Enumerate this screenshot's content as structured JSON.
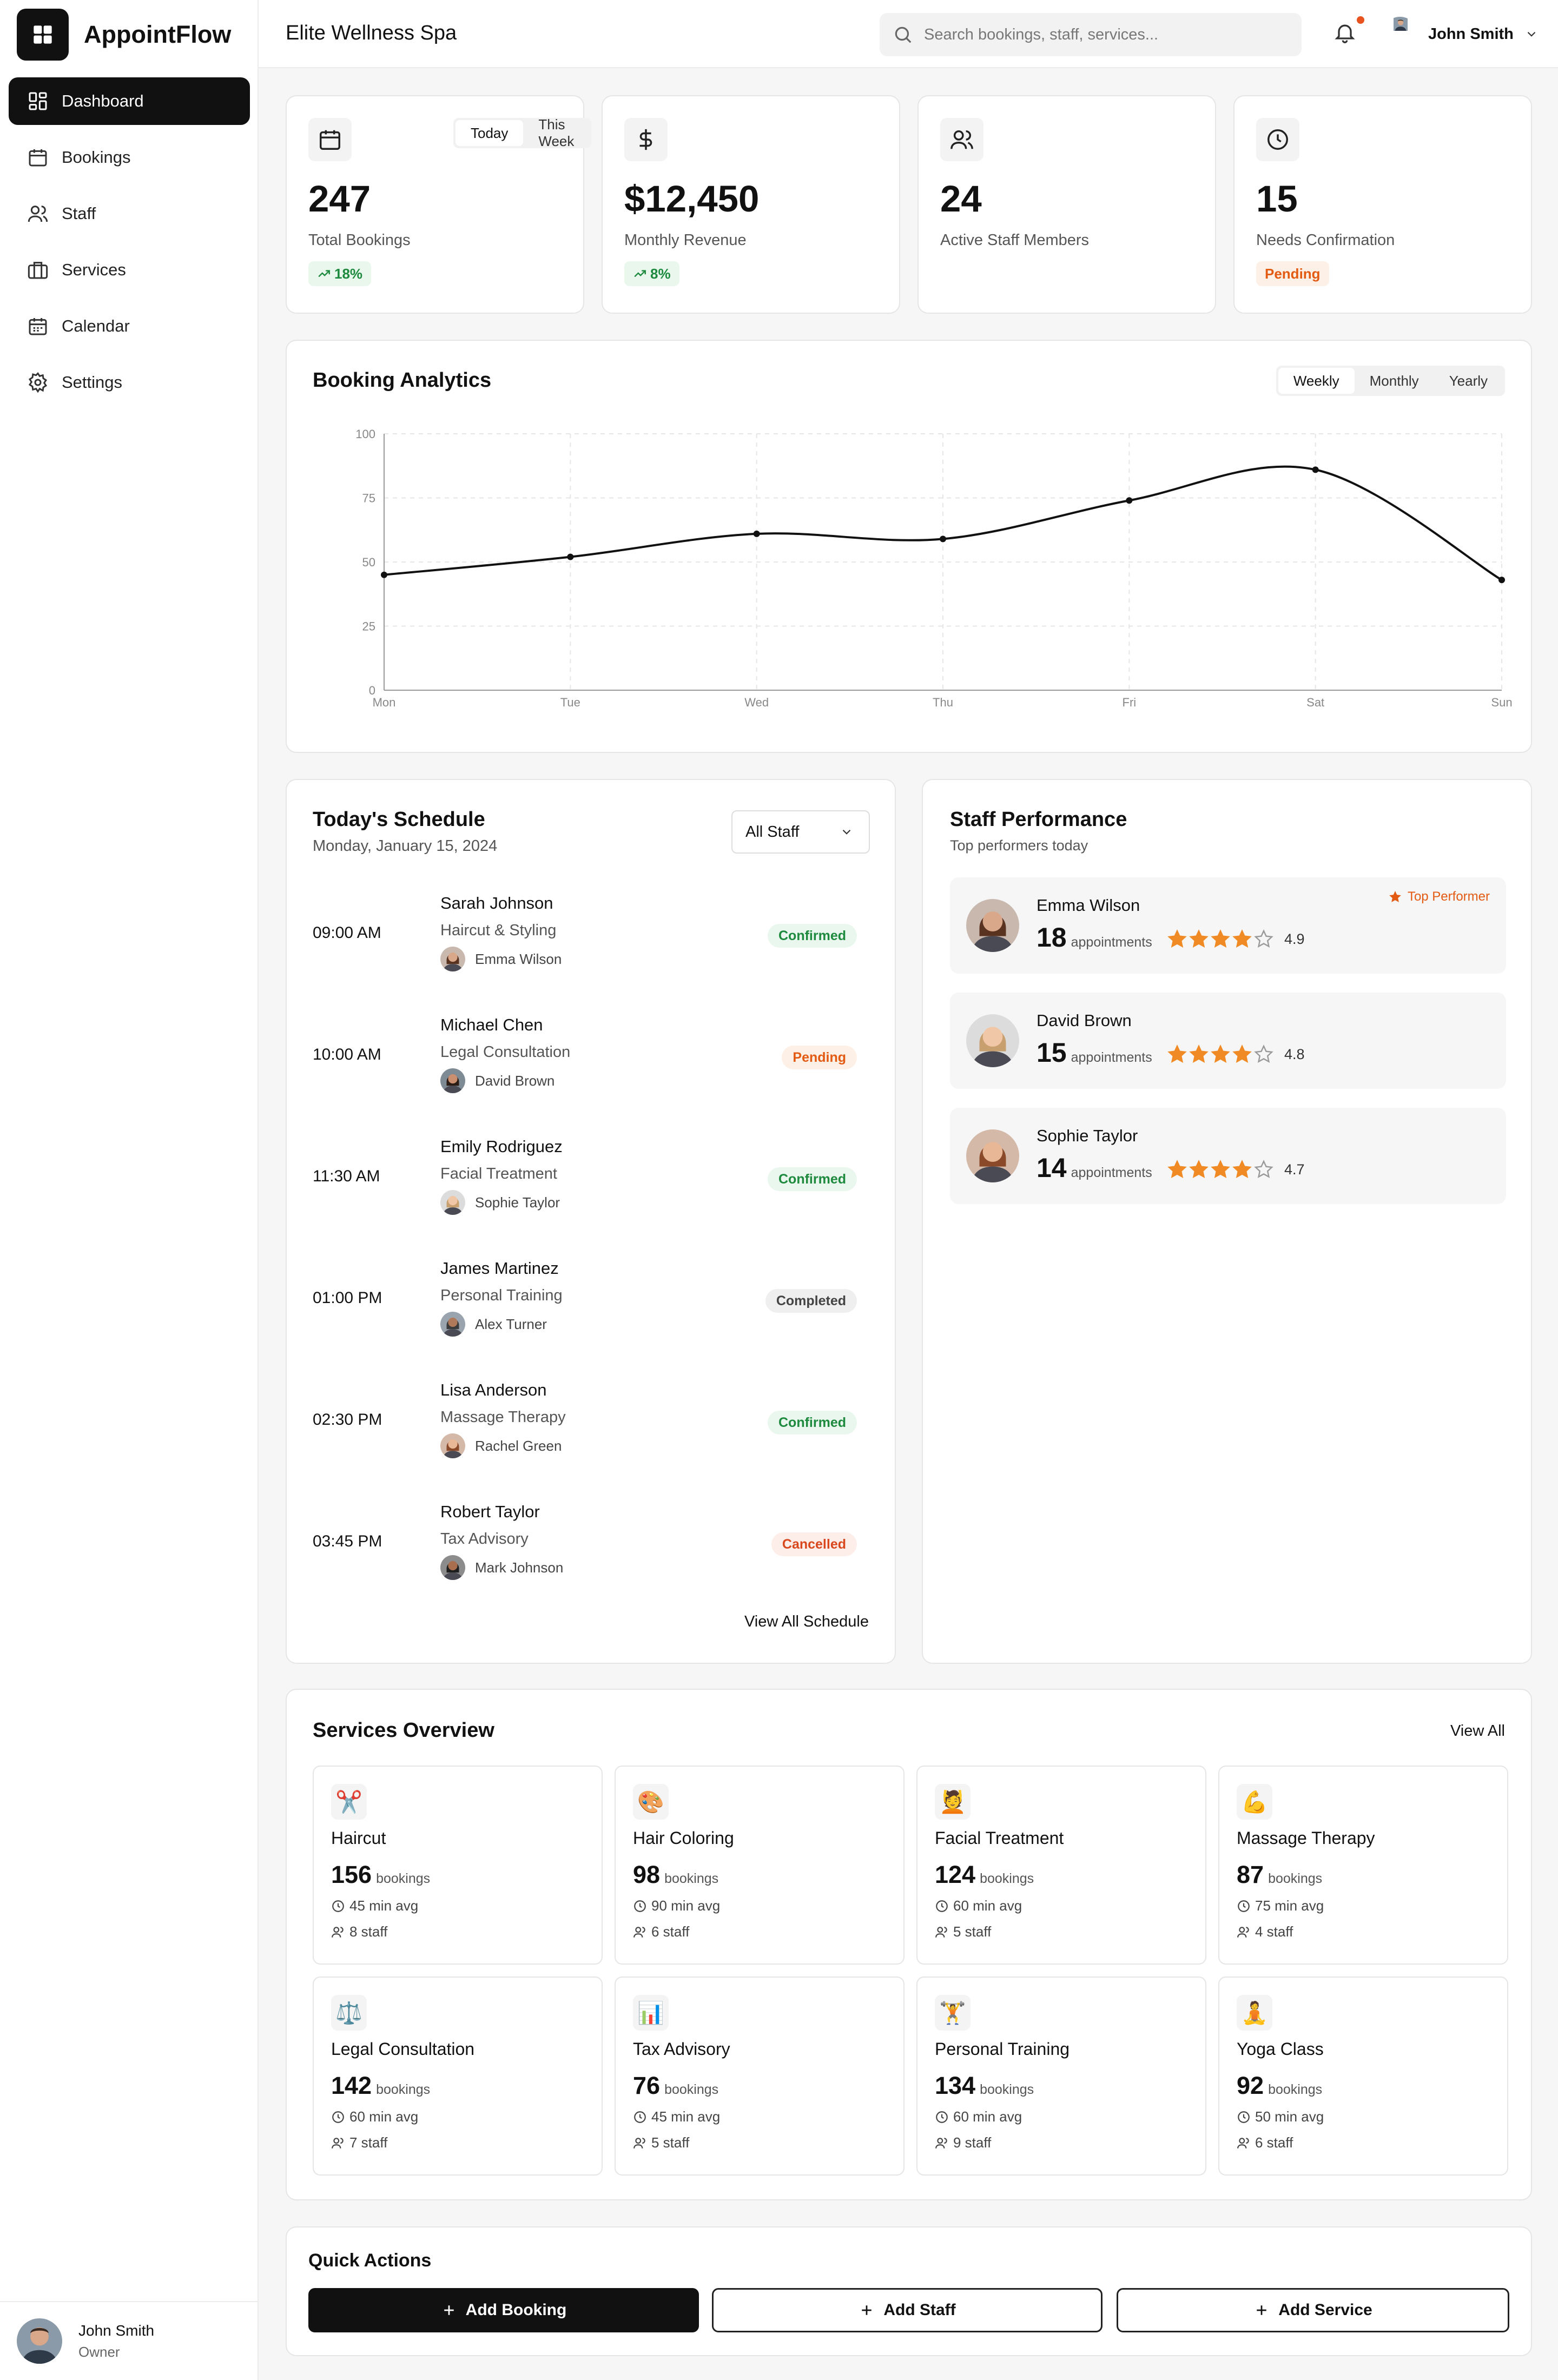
{
  "app": {
    "name": "AppointFlow",
    "org": "Elite Wellness Spa"
  },
  "sidebar": {
    "items": [
      {
        "label": "Dashboard",
        "icon": "dashboard-icon",
        "active": true
      },
      {
        "label": "Bookings",
        "icon": "calendar-icon"
      },
      {
        "label": "Staff",
        "icon": "users-icon"
      },
      {
        "label": "Services",
        "icon": "briefcase-icon"
      },
      {
        "label": "Calendar",
        "icon": "calendar-grid-icon"
      },
      {
        "label": "Settings",
        "icon": "gear-icon"
      }
    ],
    "user": {
      "name": "John Smith",
      "role": "Owner"
    }
  },
  "header": {
    "search_placeholder": "Search bookings, staff, services...",
    "user_name": "John Smith"
  },
  "stats": {
    "range_tabs": [
      "Today",
      "This Week"
    ],
    "bookings": {
      "value": "247",
      "label": "Total Bookings",
      "trend": "18%"
    },
    "revenue": {
      "value": "$12,450",
      "label": "Monthly Revenue",
      "trend": "8%"
    },
    "staff": {
      "value": "24",
      "label": "Active Staff Members"
    },
    "confirm": {
      "value": "15",
      "label": "Needs Confirmation",
      "badge": "Pending"
    }
  },
  "analytics": {
    "title": "Booking Analytics",
    "tabs": [
      "Weekly",
      "Monthly",
      "Yearly"
    ]
  },
  "chart_data": {
    "type": "line",
    "categories": [
      "Mon",
      "Tue",
      "Wed",
      "Thu",
      "Fri",
      "Sat",
      "Sun"
    ],
    "values": [
      45,
      52,
      61,
      59,
      74,
      86,
      43
    ],
    "ylim": [
      0,
      100
    ],
    "yticks": [
      0,
      25,
      50,
      75,
      100
    ],
    "grid": true
  },
  "schedule": {
    "title": "Today's Schedule",
    "date": "Monday, January 15, 2024",
    "filter": "All Staff",
    "view_all": "View All Schedule",
    "rows": [
      {
        "time": "09:00 AM",
        "client": "Sarah Johnson",
        "service": "Haircut & Styling",
        "staff": "Emma Wilson",
        "status": "Confirmed"
      },
      {
        "time": "10:00 AM",
        "client": "Michael Chen",
        "service": "Legal Consultation",
        "staff": "David Brown",
        "status": "Pending"
      },
      {
        "time": "11:30 AM",
        "client": "Emily Rodriguez",
        "service": "Facial Treatment",
        "staff": "Sophie Taylor",
        "status": "Confirmed"
      },
      {
        "time": "01:00 PM",
        "client": "James Martinez",
        "service": "Personal Training",
        "staff": "Alex Turner",
        "status": "Completed"
      },
      {
        "time": "02:30 PM",
        "client": "Lisa Anderson",
        "service": "Massage Therapy",
        "staff": "Rachel Green",
        "status": "Confirmed"
      },
      {
        "time": "03:45 PM",
        "client": "Robert Taylor",
        "service": "Tax Advisory",
        "staff": "Mark Johnson",
        "status": "Cancelled"
      }
    ]
  },
  "performance": {
    "title": "Staff Performance",
    "subtitle": "Top performers today",
    "badge": "Top Performer",
    "unit": "appointments",
    "rows": [
      {
        "name": "Emma Wilson",
        "count": "18",
        "rating": "4.9",
        "stars": 4
      },
      {
        "name": "David Brown",
        "count": "15",
        "rating": "4.8",
        "stars": 4
      },
      {
        "name": "Sophie Taylor",
        "count": "14",
        "rating": "4.7",
        "stars": 4
      }
    ]
  },
  "services": {
    "title": "Services Overview",
    "view_all": "View All",
    "unit": "bookings",
    "items": [
      {
        "name": "Haircut",
        "icon": "✂️",
        "bookings": "156",
        "avg": "45 min avg",
        "staff": "8 staff"
      },
      {
        "name": "Hair Coloring",
        "icon": "🎨",
        "bookings": "98",
        "avg": "90 min avg",
        "staff": "6 staff"
      },
      {
        "name": "Facial Treatment",
        "icon": "💆",
        "bookings": "124",
        "avg": "60 min avg",
        "staff": "5 staff"
      },
      {
        "name": "Massage Therapy",
        "icon": "💪",
        "bookings": "87",
        "avg": "75 min avg",
        "staff": "4 staff"
      },
      {
        "name": "Legal Consultation",
        "icon": "⚖️",
        "bookings": "142",
        "avg": "60 min avg",
        "staff": "7 staff"
      },
      {
        "name": "Tax Advisory",
        "icon": "📊",
        "bookings": "76",
        "avg": "45 min avg",
        "staff": "5 staff"
      },
      {
        "name": "Personal Training",
        "icon": "🏋️",
        "bookings": "134",
        "avg": "60 min avg",
        "staff": "9 staff"
      },
      {
        "name": "Yoga Class",
        "icon": "🧘",
        "bookings": "92",
        "avg": "50 min avg",
        "staff": "6 staff"
      }
    ]
  },
  "quick_actions": {
    "title": "Quick Actions",
    "buttons": [
      "Add Booking",
      "Add Staff",
      "Add Service"
    ]
  }
}
